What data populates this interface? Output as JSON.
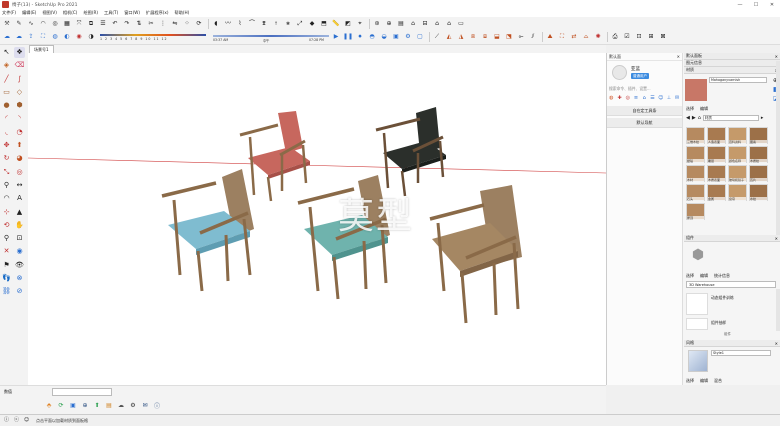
{
  "window": {
    "title": "椅子(13) - SketchUp Pro 2021",
    "controls": [
      "—",
      "☐",
      "✕"
    ]
  },
  "menu": [
    "文件(F)",
    "编辑(E)",
    "视图(V)",
    "相机(C)",
    "绘图(R)",
    "工具(T)",
    "窗口(W)",
    "扩展程序(x)",
    "帮助(H)"
  ],
  "toolbar": {
    "shadow_numbers": "1 2 3 4 5 6 7 8 9 10 11 12",
    "time_start": "03:37 AM",
    "time_noon": "中午",
    "time_end": "07:28 PM"
  },
  "scene_tab": "场景号1",
  "viewport": {
    "watermark": "莫型",
    "colors": {
      "seat_red": "#c7675e",
      "seat_black": "#2b2f2b",
      "seat_blue": "#7fbcd0",
      "seat_teal": "#6fb3ad",
      "wood": "#9c8061"
    }
  },
  "instructor": {
    "title": "默认面",
    "user_name": "亚蓝",
    "badge": "普通用户",
    "search_placeholder": "搜索命令、插件、设置...",
    "buttons": [
      "自在定工具条",
      "默认导航"
    ]
  },
  "materials_tray": {
    "tray_title": "默认面板",
    "section_entity": "图元信息",
    "section_material": "材质",
    "material_name": "Mahoganyvarnish",
    "tabs": [
      "选择",
      "编辑"
    ],
    "library": "材质",
    "swatches": [
      {
        "label": "三维木纹"
      },
      {
        "label": "人造表面"
      },
      {
        "label": "百科资料"
      },
      {
        "label": "图案"
      },
      {
        "label": "壁毯"
      },
      {
        "label": "覆层"
      },
      {
        "label": "颜色名称"
      },
      {
        "label": "木质纹"
      },
      {
        "label": "木材"
      },
      {
        "label": "木质表面"
      },
      {
        "label": "玻璃和镜子"
      },
      {
        "label": "瓦片"
      },
      {
        "label": "石头"
      },
      {
        "label": "金属"
      },
      {
        "label": "窗帘"
      },
      {
        "label": "水纹"
      },
      {
        "label": "屋顶"
      }
    ]
  },
  "components": {
    "title": "组件",
    "tabs": [
      "选择",
      "编辑",
      "统计信息"
    ],
    "search_value": "3D Warehouse",
    "items": [
      "动态组件训练",
      "组件抽样"
    ],
    "footer": "组件"
  },
  "styles": {
    "title": "风格",
    "style_name": "Style1",
    "tabs": [
      "选择",
      "编辑",
      "混合"
    ]
  },
  "measurements_label": "数值",
  "status_message": "点击平面以加载材质到面板格"
}
